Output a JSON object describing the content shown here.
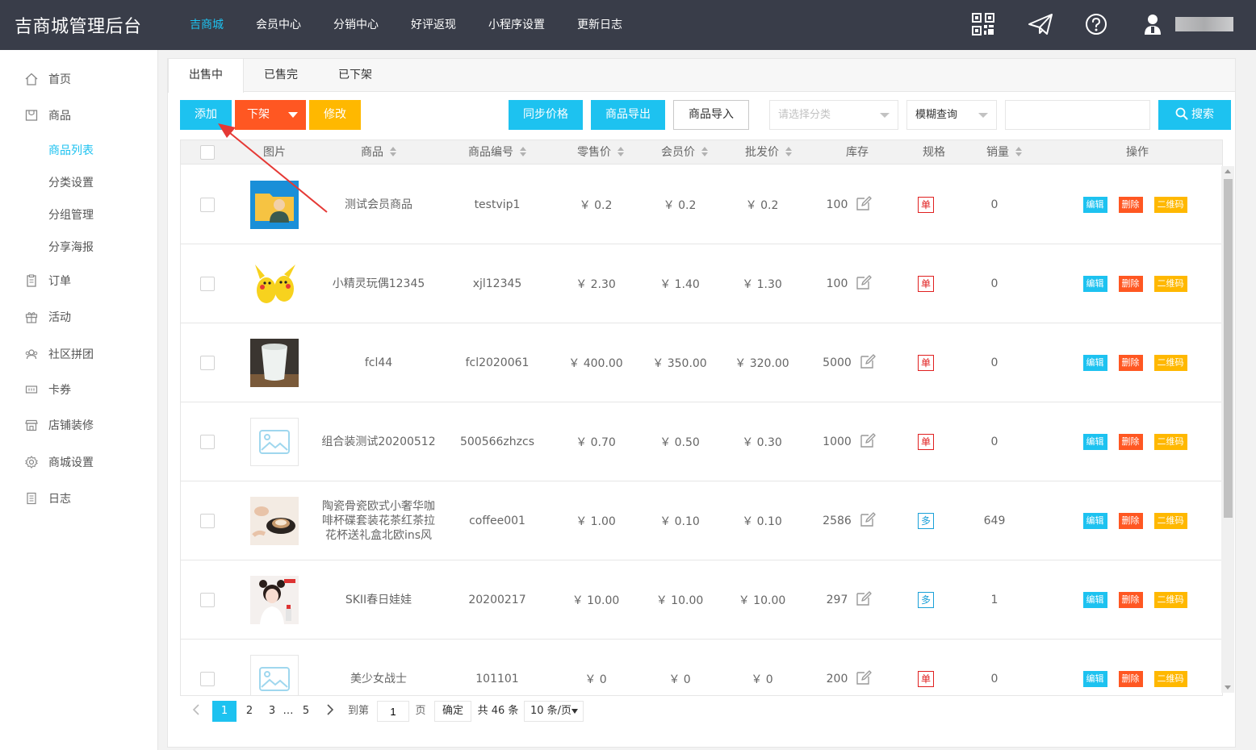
{
  "app": {
    "title": "吉商城管理后台"
  },
  "topnav": {
    "items": [
      {
        "label": "吉商城",
        "active": true
      },
      {
        "label": "会员中心"
      },
      {
        "label": "分销中心"
      },
      {
        "label": "好评返现"
      },
      {
        "label": "小程序设置"
      },
      {
        "label": "更新日志"
      }
    ],
    "icons": [
      "qrcode-icon",
      "send-icon",
      "help-icon",
      "user-icon"
    ]
  },
  "sidebar": {
    "items": [
      {
        "label": "首页",
        "icon": "home-icon"
      },
      {
        "label": "商品",
        "icon": "goods-icon"
      },
      {
        "label": "订单",
        "icon": "order-icon"
      },
      {
        "label": "活动",
        "icon": "gift-icon"
      },
      {
        "label": "社区拼团",
        "icon": "group-icon"
      },
      {
        "label": "卡券",
        "icon": "ticket-icon"
      },
      {
        "label": "店铺装修",
        "icon": "shop-icon"
      },
      {
        "label": "商城设置",
        "icon": "settings-icon"
      },
      {
        "label": "日志",
        "icon": "log-icon"
      }
    ],
    "sub_items": [
      {
        "label": "商品列表",
        "active": true
      },
      {
        "label": "分类设置"
      },
      {
        "label": "分组管理"
      },
      {
        "label": "分享海报"
      }
    ]
  },
  "tabs": [
    {
      "label": "出售中",
      "active": true
    },
    {
      "label": "已售完"
    },
    {
      "label": "已下架"
    }
  ],
  "toolbar": {
    "add": "添加",
    "offshelf": "下架",
    "modify": "修改",
    "sync_price": "同步价格",
    "export": "商品导出",
    "import": "商品导入",
    "category_placeholder": "请选择分类",
    "query_mode": "模糊查询",
    "search_value": "",
    "search": "搜索"
  },
  "table": {
    "headers": [
      "图片",
      "商品",
      "商品编号",
      "零售价",
      "会员价",
      "批发价",
      "库存",
      "规格",
      "销量",
      "操作"
    ],
    "rows": [
      {
        "name": "测试会员商品",
        "code": "testvip1",
        "retail": "￥ 0.2",
        "member": "￥ 0.2",
        "wholesale": "￥ 0.2",
        "stock": "100",
        "spec": "单",
        "spec_type": "single",
        "sales": "0",
        "thumb": "folder-user"
      },
      {
        "name": "小精灵玩偶12345",
        "code": "xjl12345",
        "retail": "￥ 2.30",
        "member": "￥ 1.40",
        "wholesale": "￥ 1.30",
        "stock": "100",
        "spec": "单",
        "spec_type": "single",
        "sales": "0",
        "thumb": "pikachu"
      },
      {
        "name": "fcl44",
        "code": "fcl2020061",
        "retail": "￥ 400.00",
        "member": "￥ 350.00",
        "wholesale": "￥ 320.00",
        "stock": "5000",
        "spec": "单",
        "spec_type": "single",
        "sales": "0",
        "thumb": "cup"
      },
      {
        "name": "组合装测试20200512",
        "code": "500566zhzcs",
        "retail": "￥ 0.70",
        "member": "￥ 0.50",
        "wholesale": "￥ 0.30",
        "stock": "1000",
        "spec": "单",
        "spec_type": "single",
        "sales": "0",
        "thumb": "placeholder"
      },
      {
        "name": "陶瓷骨瓷欧式小奢华咖啡杯碟套装花茶红茶拉花杯送礼盒北欧ins风",
        "code": "coffee001",
        "retail": "￥ 1.00",
        "member": "￥ 0.10",
        "wholesale": "￥ 0.10",
        "stock": "2586",
        "spec": "多",
        "spec_type": "multi",
        "sales": "649",
        "thumb": "coffee"
      },
      {
        "name": "SKII春日娃娃",
        "code": "20200217",
        "retail": "￥ 10.00",
        "member": "￥ 10.00",
        "wholesale": "￥ 10.00",
        "stock": "297",
        "spec": "多",
        "spec_type": "multi",
        "sales": "1",
        "thumb": "girl"
      },
      {
        "name": "美少女战士",
        "code": "101101",
        "retail": "￥ 0",
        "member": "￥ 0",
        "wholesale": "￥ 0",
        "stock": "200",
        "spec": "单",
        "spec_type": "single",
        "sales": "0",
        "thumb": "placeholder"
      }
    ],
    "actions": {
      "edit": "编辑",
      "delete": "删除",
      "qrcode": "二维码"
    }
  },
  "pagination": {
    "pages": [
      "1",
      "2",
      "3",
      "…",
      "5"
    ],
    "current": "1",
    "goto_label": "到第",
    "goto_value": "1",
    "page_label": "页",
    "confirm": "确定",
    "total": "共 46 条",
    "page_size": "10 条/页"
  },
  "colors": {
    "accent": "#1dc2f0",
    "danger": "#ff5722",
    "warn": "#ffb800",
    "header_bg": "#393d49"
  }
}
